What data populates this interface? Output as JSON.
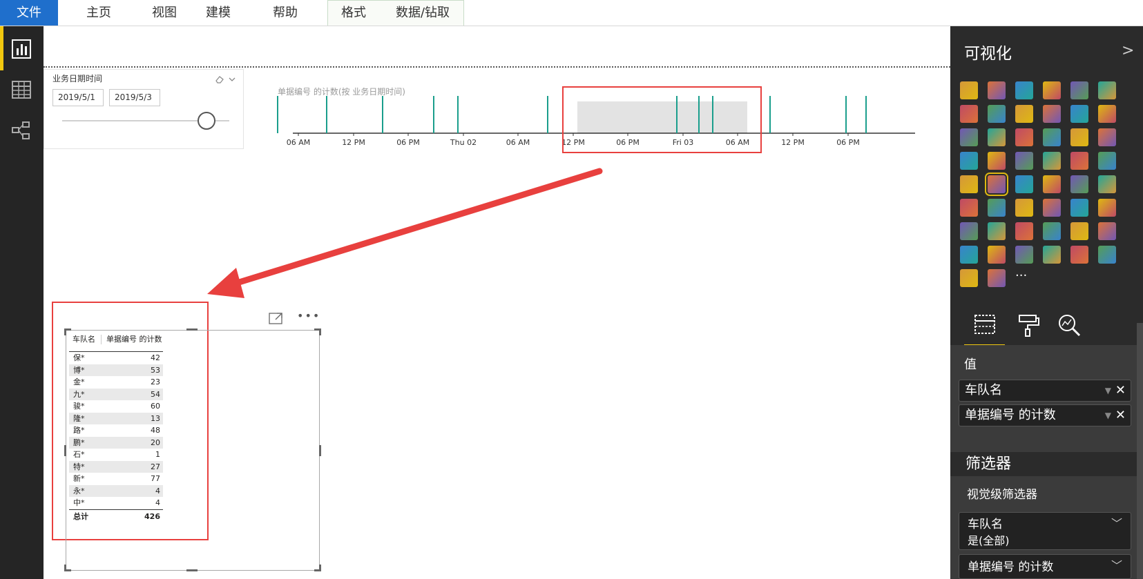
{
  "ribbon": {
    "tabs": [
      "文件",
      "主页",
      "视图",
      "建模",
      "帮助",
      "格式",
      "数据/钻取"
    ]
  },
  "slicer": {
    "title": "业务日期时间",
    "start_date": "2019/5/1",
    "end_date": "2019/5/3",
    "slider_position": 1.0
  },
  "timeline": {
    "title": "单据编号 的计数(按 业务日期时间)",
    "ticks": [
      "06 AM",
      "12 PM",
      "06 PM",
      "Thu 02",
      "06 AM",
      "12 PM",
      "06 PM",
      "Fri 03",
      "06 AM",
      "12 PM",
      "06 PM"
    ]
  },
  "table": {
    "headers": [
      "车队名",
      "单据编号 的计数"
    ],
    "rows": [
      [
        "保*",
        "42"
      ],
      [
        "博*",
        "53"
      ],
      [
        "金*",
        "23"
      ],
      [
        "九*",
        "54"
      ],
      [
        "骏*",
        "60"
      ],
      [
        "隆*",
        "13"
      ],
      [
        "路*",
        "48"
      ],
      [
        "鹏*",
        "20"
      ],
      [
        "石*",
        "1"
      ],
      [
        "特*",
        "27"
      ],
      [
        "新*",
        "77"
      ],
      [
        "永*",
        "4"
      ],
      [
        "中*",
        "4"
      ]
    ],
    "total_label": "总计",
    "total_value": "426"
  },
  "pane": {
    "title": "可视化",
    "values_title": "值",
    "fields": [
      "车队名",
      "单据编号 的计数"
    ],
    "filters_title": "筛选器",
    "visual_filters_title": "视觉级筛选器",
    "filter_cards": [
      {
        "name": "车队名",
        "value": "是(全部)"
      },
      {
        "name": "单据编号 的计数",
        "value": ""
      }
    ]
  }
}
